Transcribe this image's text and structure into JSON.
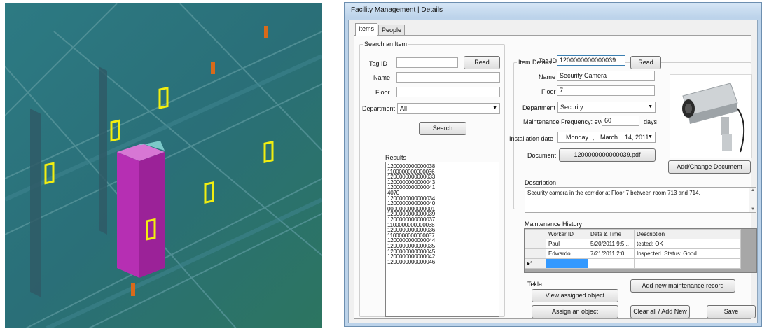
{
  "window": {
    "title": "Facility Management | Details"
  },
  "tabs": [
    {
      "label": "Items",
      "active": true
    },
    {
      "label": "People",
      "active": false
    }
  ],
  "search": {
    "legend": "Search an Item",
    "tag_label": "Tag ID",
    "tag_value": "",
    "read_label": "Read",
    "name_label": "Name",
    "name_value": "",
    "floor_label": "Floor",
    "floor_value": "",
    "department_label": "Department",
    "department_value": "All",
    "search_label": "Search",
    "results_label": "Results",
    "results": [
      "1200000000000038",
      "1100000000000036",
      "1200000000000033",
      "1200000000000043",
      "1200000000000041",
      "4070",
      "1200000000000034",
      "1200000000000040",
      "0000000000000001",
      "1200000000000039",
      "1200000000000037",
      "1100000000000038",
      "1200000000000036",
      "1100000000000037",
      "1200000000000044",
      "1200000000000035",
      "1200000000000045",
      "1200000000000042",
      "1200000000000046"
    ]
  },
  "details": {
    "legend": "Item Details",
    "tag_label": "Tag ID",
    "tag_value": "1200000000000039",
    "read_label": "Read",
    "name_label": "Name",
    "name_value": "Security Camera",
    "floor_label": "Floor",
    "floor_value": "7",
    "department_label": "Department",
    "department_value": "Security",
    "maint_freq_label": "Maintenance Frequency: every",
    "maint_freq_value": "60",
    "maint_freq_unit": "days",
    "install_label": "Installation date",
    "install_weekday": "Monday",
    "install_sep": ",",
    "install_date": "March    14, 2011",
    "document_label": "Document",
    "document_value": "1200000000000039.pdf",
    "change_doc_label": "Add/Change Document",
    "description_label": "Description",
    "description_value": "Security camera in the corridor at Floor 7 between room 713 and 714."
  },
  "history": {
    "label": "Maintenance History",
    "columns": [
      "Worker ID",
      "Date & Time",
      "Description"
    ],
    "rows": [
      {
        "worker": "Paul",
        "datetime": "5/20/2011 9:5...",
        "description": "tested: OK"
      },
      {
        "worker": "Edwardo",
        "datetime": "7/21/2011 2:0...",
        "description": "Inspected. Status: Good"
      }
    ],
    "new_row_marker": "▸*"
  },
  "tekla": {
    "label": "Tekla",
    "view_label": "View assigned object",
    "assign_label": "Assign an object"
  },
  "actions": {
    "add_record_label": "Add new maintenance record",
    "clear_label": "Clear all / Add New",
    "save_label": "Save"
  },
  "colors": {
    "viewport_bg": "#2a6f7a",
    "column_magenta": "#b62fb3",
    "marker_yellow": "#f2ee10",
    "marker_orange": "#d86a1a",
    "window_frame": "#bcd3ea"
  },
  "icons": {
    "dropdown": "chevron-down-icon",
    "scroll_up": "scroll-up-icon",
    "scroll_down": "scroll-down-icon"
  }
}
